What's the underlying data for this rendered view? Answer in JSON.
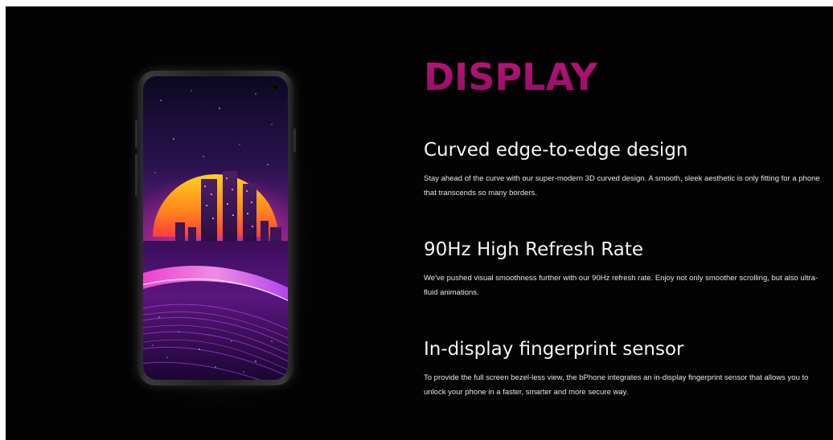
{
  "section": {
    "title": "DISPLAY",
    "title_color": "#b0136f"
  },
  "features": [
    {
      "heading": "Curved edge-to-edge design",
      "description": "Stay ahead of the curve with our super-modern 3D curved design. A smooth, sleek aesthetic is only fitting for a phone that transcends so many borders."
    },
    {
      "heading": "90Hz High Refresh Rate",
      "description": "We've pushed visual smoothness further with our 90Hz refresh rate. Enjoy not only smoother scrolling, but also ultra-fluid animations."
    },
    {
      "heading": "In-display fingerprint sensor",
      "description": "To provide the full screen bezel-less view, the bPhone integrates an in-display fingerprint sensor that allows you to unlock your phone in a faster, smarter and more secure way."
    }
  ],
  "colors": {
    "background": "#030303",
    "heading_text": "#f4f4f4",
    "body_text": "#e6e6e6",
    "accent_magenta": "#b0136f"
  }
}
